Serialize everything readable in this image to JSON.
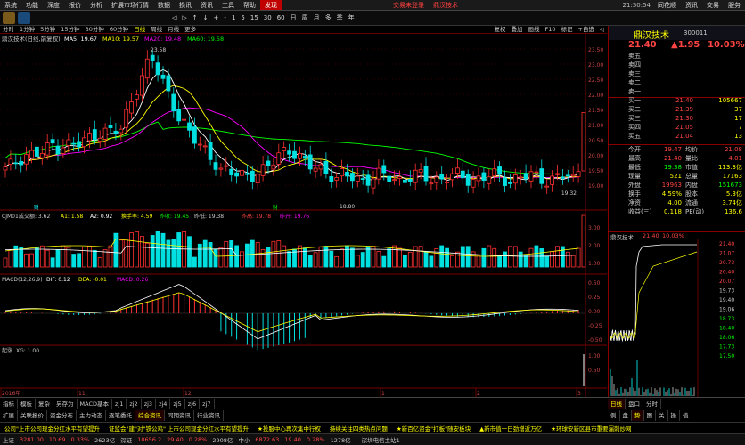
{
  "menu": {
    "items": [
      "系统",
      "功能",
      "深度",
      "报价",
      "分析",
      "扩展市场行情",
      "数据",
      "损讯",
      "资讯",
      "工具",
      "帮助",
      "发现"
    ],
    "login": "交易未登录",
    "stock_title": "鼎汉技术",
    "clock": "21:50:54",
    "right_items": [
      "同花顺",
      "资讯",
      "交易",
      "服务"
    ]
  },
  "toolbar": {
    "nav": [
      "◁",
      "▷",
      "↑",
      "↓",
      "+",
      "-",
      "1",
      "5",
      "15",
      "30",
      "60",
      "日",
      "周",
      "月",
      "多",
      "季",
      "年"
    ]
  },
  "period": {
    "items": [
      "分时",
      "1分钟",
      "5分钟",
      "15分钟",
      "30分钟",
      "60分钟",
      "日线",
      "周线",
      "月线",
      "更多"
    ],
    "selected": "日线",
    "right": [
      "复权",
      "叠加",
      "画线",
      "F10",
      "标记",
      "+自选",
      "◁"
    ]
  },
  "ma_legend": {
    "title": "鼎汉技术(日线,前复权)",
    "ma5": "MA5: 19.67",
    "ma10": "MA10: 19.57",
    "ma20": "MA20: 19.48",
    "ma60": "MA60: 19.58",
    "colors": {
      "ma5": "#ffffff",
      "ma10": "#ffff00",
      "ma20": "#ff00ff",
      "ma60": "#00ff00"
    }
  },
  "annotations": {
    "high": "23.58",
    "low": "18.80",
    "last": "19.32",
    "flag": "财",
    "flag2": "财"
  },
  "vol_legend": {
    "title": "CJM01",
    "vol": "成交额: 3.62",
    "a1": "A1: 1.58",
    "a2": "A2: 0.92",
    "turnover": "换手率: 4.59",
    "close": "昨收: 19.45",
    "prev": "昨低: 19.38",
    "high": "昨高: 19.78",
    "open": "昨开: 19.76"
  },
  "macd_legend": {
    "title": "MACD(12,26,9)",
    "dif": "DIF: 0.12",
    "dea": "DEA: -0.01",
    "macd": "MACD: 0.26"
  },
  "xg_legend": {
    "title": "起涨",
    "xg": "XG: 1.00"
  },
  "price_axis": [
    "23.50",
    "23.00",
    "22.50",
    "22.00",
    "21.50",
    "21.00",
    "20.50",
    "20.00",
    "19.50",
    "19.00"
  ],
  "vol_axis": [
    "3.00",
    "2.00",
    "1.00"
  ],
  "macd_axis": [
    "0.50",
    "0.25",
    "0.00",
    "-0.25",
    "-0.50"
  ],
  "xg_axis": [
    "1.00",
    "0.50"
  ],
  "time_axis": [
    "2016年",
    "11",
    "12",
    "1",
    "2",
    "3"
  ],
  "quote": {
    "name": "鼎汉技术",
    "code": "300011",
    "price": "21.40",
    "change": "▲1.95",
    "pct": "10.03%",
    "sells": [
      [
        "卖五",
        "",
        ""
      ],
      [
        "卖四",
        "",
        ""
      ],
      [
        "卖三",
        "",
        ""
      ],
      [
        "卖二",
        "",
        ""
      ],
      [
        "卖一",
        "",
        ""
      ]
    ],
    "buys": [
      [
        "买一",
        "21.40",
        "105667"
      ],
      [
        "买二",
        "21.39",
        "37"
      ],
      [
        "买三",
        "21.30",
        "17"
      ],
      [
        "买四",
        "21.05",
        "7"
      ],
      [
        "买五",
        "21.04",
        "13"
      ]
    ],
    "stats": [
      [
        "今开",
        "19.47",
        "均价",
        "21.08"
      ],
      [
        "最高",
        "21.40",
        "量比",
        "4.01"
      ],
      [
        "最低",
        "19.38",
        "市值",
        "113.3亿"
      ],
      [
        "现量",
        "521",
        "总量",
        "17163"
      ],
      [
        "外盘",
        "19963",
        "内盘",
        "151673"
      ],
      [
        "换手",
        "4.59%",
        "股本",
        "5.3亿"
      ],
      [
        "净资",
        "4.00",
        "流通",
        "3.74亿"
      ],
      [
        "收益(三)",
        "0.118",
        "PE(动)",
        "136.6"
      ]
    ],
    "mini_title": "鼎汉技术",
    "mini_price": "21.40",
    "mini_pct": "10.03%",
    "mini_axis": [
      "21.40",
      "21.07",
      "20.73",
      "20.40",
      "20.07",
      "19.73",
      "19.40",
      "19.06",
      "18.73",
      "18.40",
      "18.06",
      "17.73",
      "17.50"
    ]
  },
  "bottom": {
    "tabs1": [
      "指标",
      "模板",
      "复杂",
      "另存为",
      "MACD基本",
      "zj1",
      "zj2",
      "zj3",
      "zj4",
      "zj5",
      "zj6",
      "zj7"
    ],
    "tabs2": [
      "扩展",
      "关联报价",
      "资金分布",
      "主力动态",
      "逐笔委托",
      "综合资讯",
      "同期资讯",
      "行业资讯"
    ],
    "rtabs": [
      "日线",
      "盘口",
      "分时"
    ],
    "rtabs2": [
      "例",
      "盘",
      "势",
      "图",
      "关",
      "操",
      "值"
    ]
  },
  "ticker": [
    "公司\"上市公司现金分红水平有望提升",
    "证监会\"建\"对\"铁公鸡\" 上市公司现金分红水平有望提升",
    "★投服中心再次集中行权",
    "持续关注四类热点问题",
    "★新百亿资金\"打板\"随安板块",
    "▲新市值一日劲增近万亿",
    "★环球安新区县市重要漏刺炒网"
  ],
  "status": {
    "sh": "上证",
    "sh_val": "3281.00",
    "sh_chg": "10.69",
    "sh_pct": "0.33%",
    "sh_amt": "2623亿",
    "sz": "深证",
    "sz_val": "10656.2",
    "sz_chg": "29.40",
    "sz_pct": "0.28%",
    "sz_amt": "2908亿",
    "cy": "中小",
    "cy_val": "6872.63",
    "cy_chg": "19.40",
    "cy_pct": "0.28%",
    "cy_amt": "1278亿",
    "server": "深圳电信主站1"
  }
}
